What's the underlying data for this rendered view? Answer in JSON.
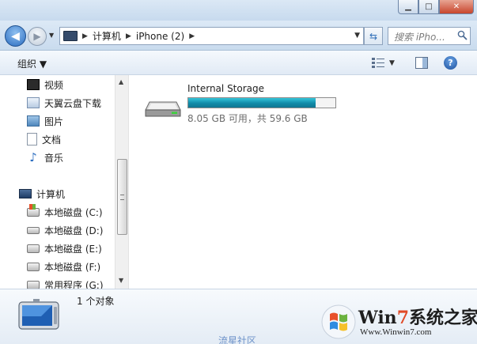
{
  "window": {
    "minimize_glyph": "▁",
    "maximize_glyph": "□",
    "close_glyph": "✕"
  },
  "navigation": {
    "back_glyph": "◀",
    "forward_glyph": "▶",
    "history_glyph": "▼",
    "breadcrumb": [
      "计算机",
      "iPhone (2)"
    ],
    "crumb_separator": "▶",
    "address_dropdown_glyph": "▼",
    "refresh_glyph": "⇆",
    "search_placeholder": "搜索 iPho..."
  },
  "toolbar": {
    "organize_label": "组织 ▼",
    "view_dropdown_glyph": "▼",
    "help_glyph": "?"
  },
  "sidebar": {
    "items": [
      {
        "label": "视频",
        "icon": "video-icon"
      },
      {
        "label": "天翼云盘下载",
        "icon": "download-folder-icon"
      },
      {
        "label": "图片",
        "icon": "pictures-icon"
      },
      {
        "label": "文档",
        "icon": "documents-icon"
      },
      {
        "label": "音乐",
        "icon": "music-icon"
      }
    ],
    "computer": {
      "label": "计算机",
      "icon": "computer-icon"
    },
    "drives": [
      {
        "label": "本地磁盘 (C:)",
        "icon": "windows-drive-icon"
      },
      {
        "label": "本地磁盘 (D:)",
        "icon": "drive-icon"
      },
      {
        "label": "本地磁盘 (E:)",
        "icon": "drive-icon"
      },
      {
        "label": "本地磁盘 (F:)",
        "icon": "drive-icon"
      },
      {
        "label": "常用程序 (G:)",
        "icon": "drive-icon"
      }
    ],
    "scroll_up_glyph": "▲",
    "scroll_down_glyph": "▼"
  },
  "content": {
    "storage": {
      "name": "Internal Storage",
      "space": "8.05 GB 可用，共 59.6 GB",
      "used_fraction": 0.865,
      "bar_color": "#118aa8"
    }
  },
  "details": {
    "count": "1 个对象"
  },
  "watermark": {
    "brand_1": "Win",
    "brand_2": "7",
    "brand_3": "系统之家",
    "url": "Www.Winwin7.com",
    "footer": "流星社区"
  }
}
